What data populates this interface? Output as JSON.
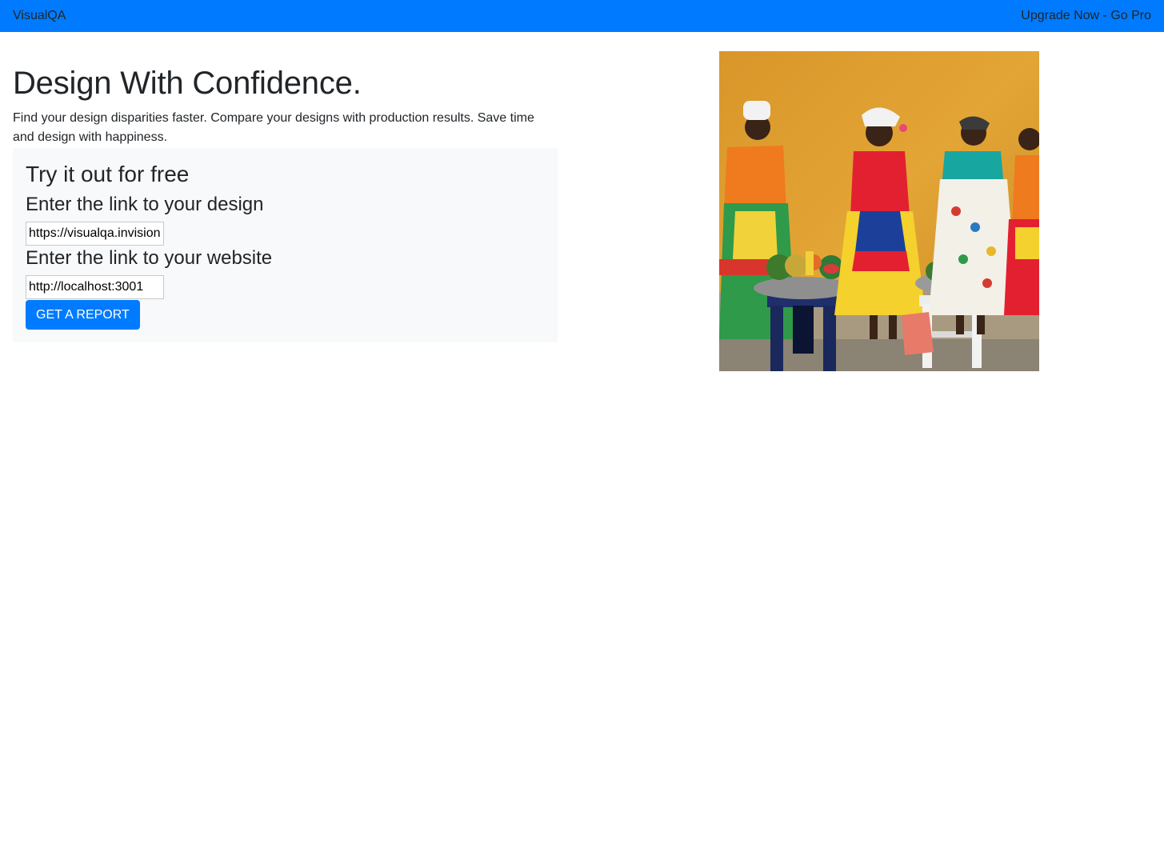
{
  "navbar": {
    "brand": "VisualQA",
    "upgrade_link": "Upgrade Now - Go Pro",
    "bg_color": "#007bff"
  },
  "hero": {
    "title": "Design With Confidence.",
    "subtitle": "Find your design disparities faster. Compare your designs with production results. Save time and design with happiness."
  },
  "form": {
    "title": "Try it out for free",
    "design_label": "Enter the link to your design",
    "design_value": "https://visualqa.invision",
    "website_label": "Enter the link to your website",
    "website_value": "http://localhost:3001",
    "submit_label": "GET A REPORT"
  },
  "image": {
    "subject": "women-in-colorful-dresses-with-fruit-bowls"
  }
}
